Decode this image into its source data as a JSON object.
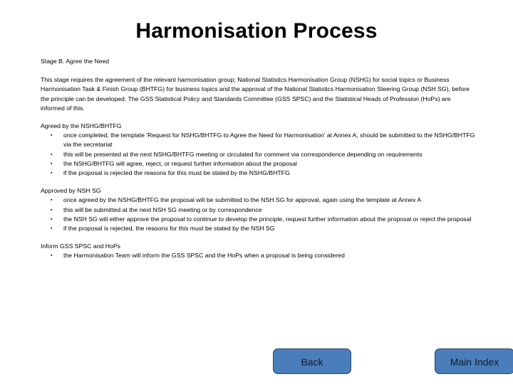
{
  "slide": {
    "title": "Harmonisation Process",
    "stage_label": "Stage B. Agree the Need",
    "intro_paragraph": "This stage requires the agreement of the relevant harmonisation group; National Statistics Harmonisation Group (NSHG) for social topics or Business Harmonisation Task & Finish Group (BHTFG) for business topics and the approval of the  National Statistics Harmonisation Steering Group (NSH SG), before the  principle can be developed. The GSS Statistical Policy and Standards Committee (GSS SPSC) and the Statistical Heads of Profession (HoPs) are informed of this.",
    "sections": [
      {
        "heading": "Agreed by the NSHG/BHTFG",
        "bullets": [
          "once completed, the template 'Request for NSHG/BHTFG to Agree the Need for Harmonisation' at Annex A, should be submitted to the NSHG/BHTFG via the secretariat",
          "this will be presented at the next NSHG/BHTFG meeting or circulated for comment via correspondence depending on requirements",
          "the  NSHG/BHTFG will agree, reject, or request further information about the proposal",
          "if the proposal is rejected the reasons for this must be stated by the NSHG/BHTFG"
        ]
      },
      {
        "heading": "Approved by NSH SG",
        "bullets": [
          "once agreed by the NSHG/BHTFG the proposal will be submitted to the NSH SG for approval, again using the template at Annex A",
          "this will be submitted at the next NSH SG meeting or by correspondence",
          "the  NSH SG  will either approve the proposal to continue to develop the principle, request further information about the proposal or reject the proposal",
          "if the proposal is rejected, the reasons for this must be stated by the NSH SG"
        ]
      },
      {
        "heading": "Inform GSS SPSC and HoPs",
        "bullets": [
          "the Harmonisation Team will inform the GSS SPSC and the HoPs when a proposal is being considered"
        ]
      }
    ],
    "bullet_glyph": "▪"
  },
  "navigation": {
    "back_label": "Back",
    "main_index_label": "Main Index",
    "button_fill": "#4a7ebb",
    "button_border": "#27476b"
  }
}
